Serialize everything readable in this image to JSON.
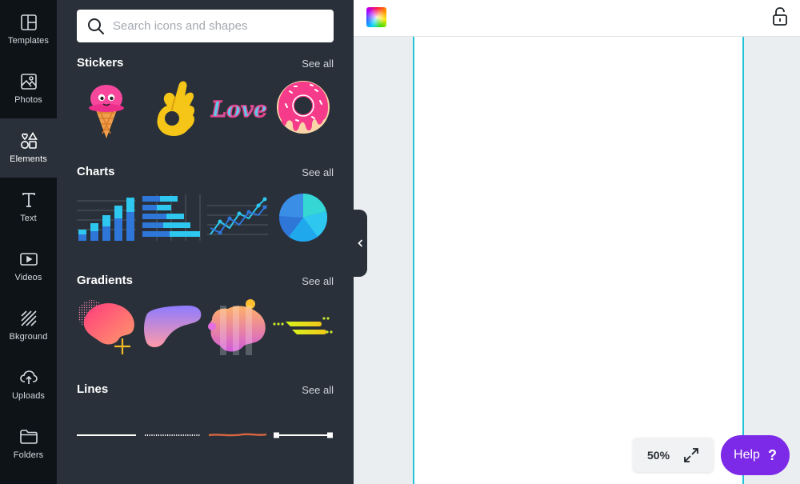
{
  "rail": {
    "items": [
      {
        "label": "Templates",
        "icon": "templates-icon"
      },
      {
        "label": "Photos",
        "icon": "photos-icon"
      },
      {
        "label": "Elements",
        "icon": "elements-icon",
        "active": true
      },
      {
        "label": "Text",
        "icon": "text-icon"
      },
      {
        "label": "Videos",
        "icon": "videos-icon"
      },
      {
        "label": "Bkground",
        "icon": "background-icon"
      },
      {
        "label": "Uploads",
        "icon": "uploads-icon"
      },
      {
        "label": "Folders",
        "icon": "folders-icon"
      }
    ]
  },
  "search": {
    "placeholder": "Search icons and shapes"
  },
  "sections": {
    "stickers": {
      "title": "Stickers",
      "see_all": "See all"
    },
    "charts": {
      "title": "Charts",
      "see_all": "See all"
    },
    "gradients": {
      "title": "Gradients",
      "see_all": "See all"
    },
    "lines": {
      "title": "Lines",
      "see_all": "See all"
    }
  },
  "sticker_text": "Love",
  "zoom": {
    "value": "50%"
  },
  "help": {
    "label": "Help",
    "glyph": "?"
  },
  "colors": {
    "accent": "#7d2ae8",
    "panel": "#293039",
    "rail": "#0e1318",
    "guide": "#22c3d6"
  }
}
